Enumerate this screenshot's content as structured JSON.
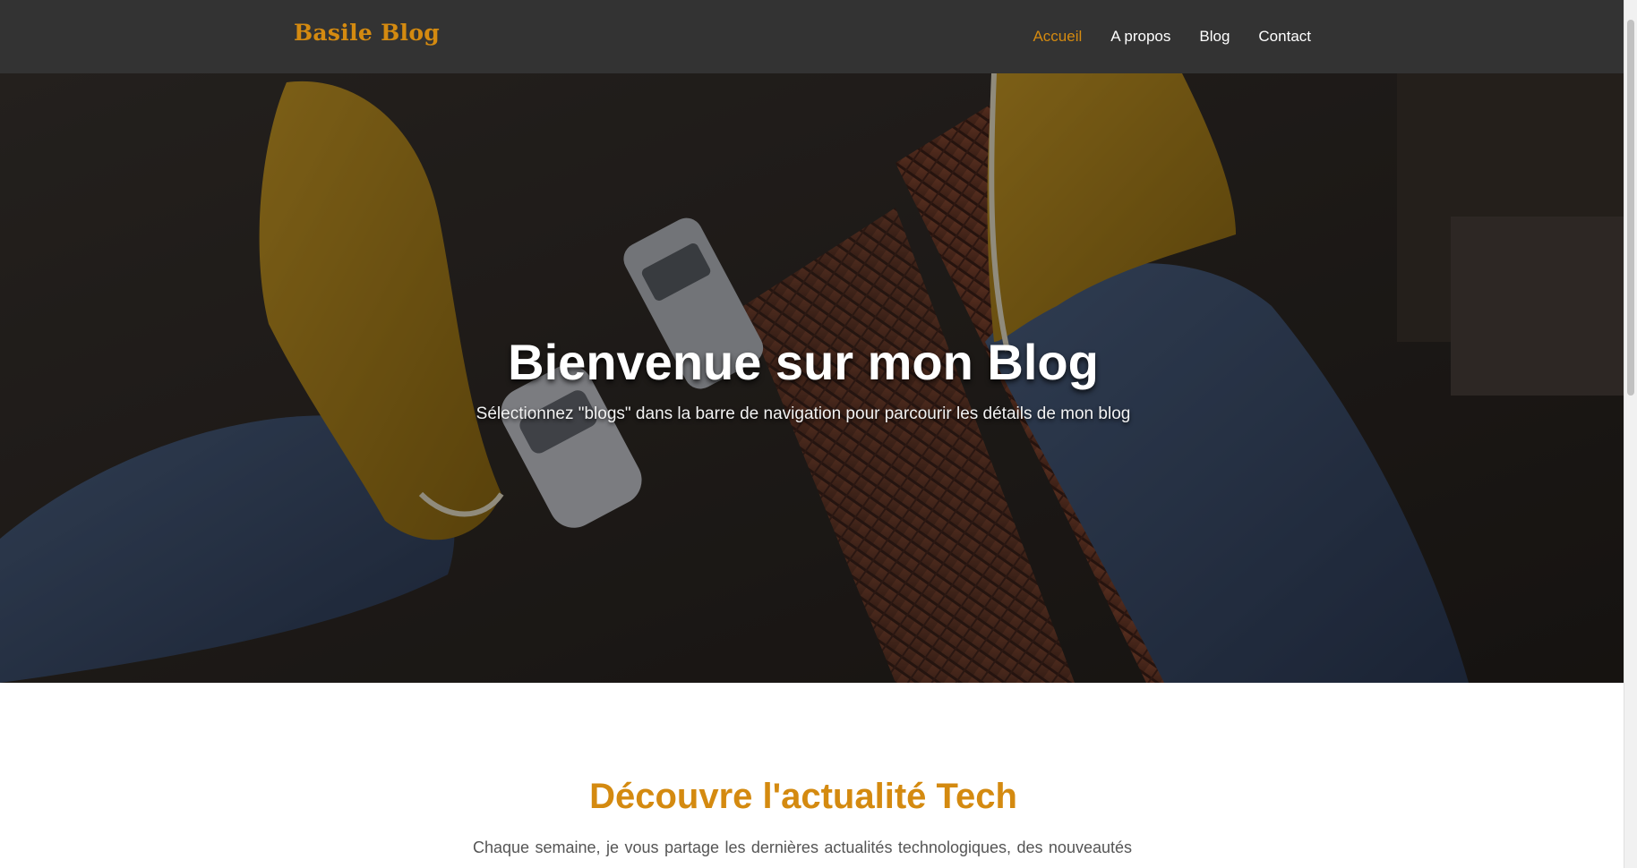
{
  "brand": "Basile Blog",
  "nav": {
    "items": [
      {
        "label": "Accueil",
        "active": true
      },
      {
        "label": "A propos",
        "active": false
      },
      {
        "label": "Blog",
        "active": false
      },
      {
        "label": "Contact",
        "active": false
      }
    ]
  },
  "hero": {
    "title": "Bienvenue sur mon Blog",
    "subtitle": "Sélectionnez \"blogs\" dans la barre de navigation pour parcourir les détails de mon blog"
  },
  "section": {
    "title": "Découvre l'actualité Tech",
    "text": "Chaque semaine, je vous partage les dernières actualités technologiques, des nouveautés en matière de logiciels, hardware, et bien plus encore. Chaque article est conçu pour vous"
  },
  "colors": {
    "accent": "#d48a10",
    "navbar": "#333333"
  }
}
